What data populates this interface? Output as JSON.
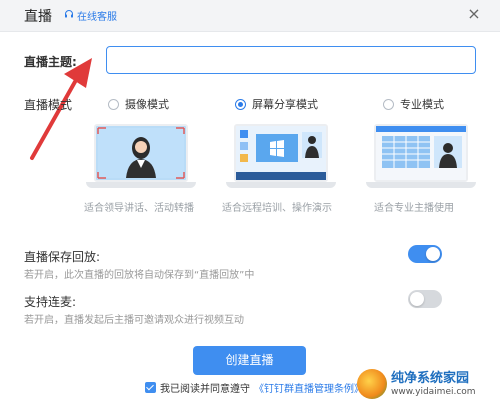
{
  "window": {
    "title": "直播",
    "customer_service": "在线客服",
    "close_glyph": "×"
  },
  "topic": {
    "label": "直播主题:",
    "value": "",
    "placeholder": ""
  },
  "mode": {
    "label": "直播模式",
    "options": [
      {
        "label": "摄像模式",
        "checked": false,
        "desc": "适合领导讲话、活动转播"
      },
      {
        "label": "屏幕分享模式",
        "checked": true,
        "desc": "适合远程培训、操作演示"
      },
      {
        "label": "专业模式",
        "checked": false,
        "desc": "适合专业主播使用"
      }
    ]
  },
  "save_replay": {
    "title": "直播保存回放:",
    "subtitle": "若开启，此次直播的回放将自动保存到“直播回放”中",
    "enabled": true
  },
  "co_host": {
    "title": "支持连麦:",
    "subtitle": "若开启，直播发起后主播可邀请观众进行视频互动",
    "enabled": false
  },
  "actions": {
    "create_label": "创建直播"
  },
  "agreement": {
    "checked": true,
    "text": "我已阅读并同意遵守",
    "link": "《钉钉群直播管理条例》"
  },
  "watermark": {
    "name": "纯净系统家园",
    "url": "www.yidaimei.com"
  },
  "colors": {
    "accent": "#3f8ef0",
    "link": "#2b7be8",
    "annotation_arrow": "#e03a3a"
  },
  "icons": {
    "customer_service": "headset-icon",
    "close": "close-icon",
    "arrow": "red-arrow-annotation"
  }
}
